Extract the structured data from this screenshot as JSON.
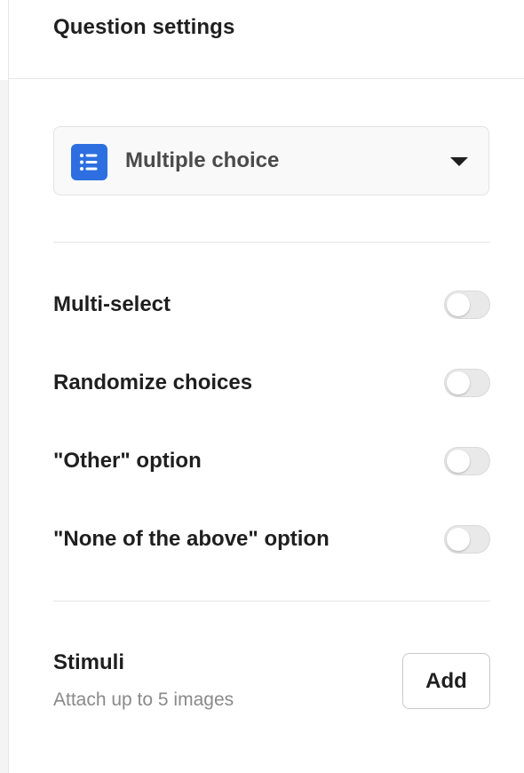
{
  "header": {
    "title": "Question settings"
  },
  "question_type": {
    "label": "Multiple choice",
    "icon": "list-icon",
    "icon_bg_color": "#2d6fe0"
  },
  "settings": [
    {
      "label": "Multi-select",
      "enabled": false
    },
    {
      "label": "Randomize choices",
      "enabled": false
    },
    {
      "label": "\"Other\" option",
      "enabled": false
    },
    {
      "label": "\"None of the above\" option",
      "enabled": false
    }
  ],
  "stimuli": {
    "title": "Stimuli",
    "subtitle": "Attach up to 5 images",
    "add_label": "Add"
  }
}
